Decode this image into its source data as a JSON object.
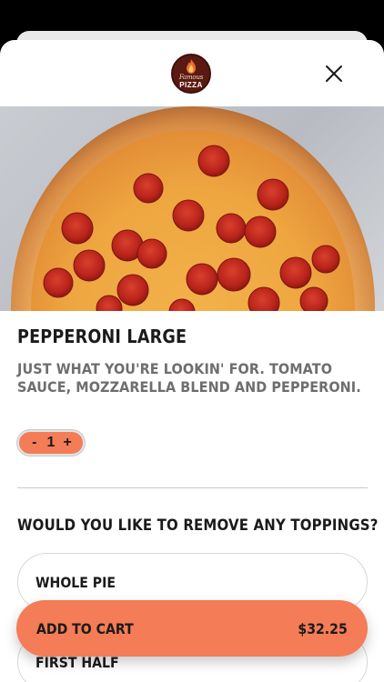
{
  "brand": {
    "logo_script": "Famous",
    "logo_word": "PIZZA"
  },
  "item": {
    "title": "PEPPERONI LARGE",
    "description": "JUST WHAT YOU'RE LOOKIN' FOR. TOMATO SAUCE, MOZZARELLA BLEND AND PEPPERONI.",
    "quantity": "1",
    "decrement_label": "-",
    "increment_label": "+"
  },
  "toppings": {
    "heading": "WOULD YOU LIKE TO REMOVE ANY TOPPINGS?",
    "options": [
      {
        "label": "WHOLE PIE"
      },
      {
        "label": "FIRST HALF"
      }
    ]
  },
  "cart": {
    "button_label": "ADD TO CART",
    "price": "$32.25"
  },
  "icons": {
    "close": "close-icon",
    "logo": "pizza-logo"
  },
  "colors": {
    "accent": "#f47c56",
    "text": "#1b1b1b",
    "muted": "#6e6e6e",
    "logo_bg": "#5a1a12"
  }
}
